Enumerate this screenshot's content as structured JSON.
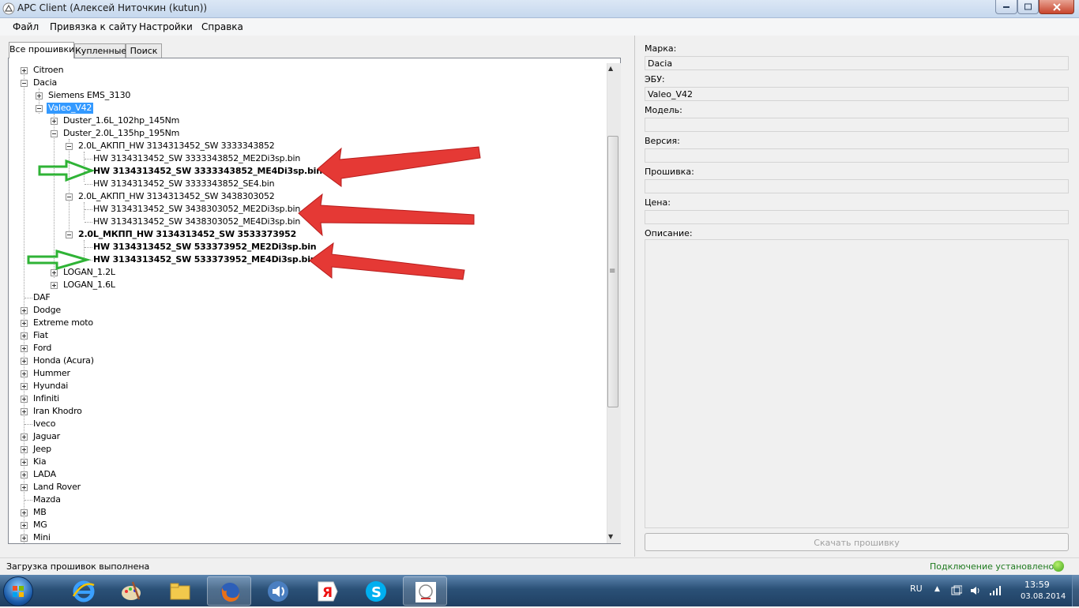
{
  "window": {
    "title": "APC Client (Алексей Ниточкин (kutun))"
  },
  "menu": [
    "Файл",
    "Привязка к сайту",
    "Настройки",
    "Справка"
  ],
  "tabs": {
    "all": "Все прошивки",
    "bought": "Купленные",
    "search": "Поиск"
  },
  "tree": {
    "citroen": "Citroen",
    "dacia": "Dacia",
    "siemens": "Siemens EMS_3130",
    "valeo": "Valeo_V42",
    "duster16": "Duster_1.6L_102hp_145Nm",
    "duster20": "Duster_2.0L_135hp_195Nm",
    "akpp1": "2.0L_АКПП_HW 3134313452_SW 3333343852",
    "akpp1_f1": "HW 3134313452_SW 3333343852_ME2Di3sp.bin",
    "akpp1_f2": "HW 3134313452_SW 3333343852_ME4Di3sp.bin",
    "akpp1_f3": "HW 3134313452_SW 3333343852_SE4.bin",
    "akpp2": "2.0L_АКПП_HW 3134313452_SW 3438303052",
    "akpp2_f1": "HW 3134313452_SW 3438303052_ME2Di3sp.bin",
    "akpp2_f2": "HW 3134313452_SW 3438303052_ME4Di3sp.bin",
    "mkpp": "2.0L_МКПП_HW 3134313452_SW 3533373952",
    "mkpp_f1": "HW 3134313452_SW 533373952_ME2Di3sp.bin",
    "mkpp_f2": "HW 3134313452_SW 533373952_ME4Di3sp.bin",
    "logan12": "LOGAN_1.2L",
    "logan16": "LOGAN_1.6L",
    "brands": [
      "DAF",
      "Dodge",
      "Extreme moto",
      "Fiat",
      "Ford",
      "Honda (Acura)",
      "Hummer",
      "Hyundai",
      "Infiniti",
      "Iran Khodro",
      "Iveco",
      "Jaguar",
      "Jeep",
      "Kia",
      "LADA",
      "Land Rover",
      "Mazda",
      "MB",
      "MG",
      "Mini"
    ]
  },
  "details": {
    "make_label": "Марка:",
    "make_value": "Dacia",
    "ecu_label": "ЭБУ:",
    "ecu_value": "Valeo_V42",
    "model_label": "Модель:",
    "model_value": "",
    "version_label": "Версия:",
    "version_value": "",
    "firmware_label": "Прошивка:",
    "firmware_value": "",
    "price_label": "Цена:",
    "price_value": "",
    "desc_label": "Описание:",
    "download_label": "Скачать прошивку"
  },
  "status": {
    "left": "Загрузка прошивок выполнена",
    "right": "Подключение установлено"
  },
  "tray": {
    "lang": "RU",
    "time": "13:59",
    "date": "03.08.2014"
  },
  "colors": {
    "selection": "#3399ff",
    "red_arrow": "#e53935",
    "green_arrow": "#2fb336",
    "status_ok": "#1e7a1e"
  }
}
